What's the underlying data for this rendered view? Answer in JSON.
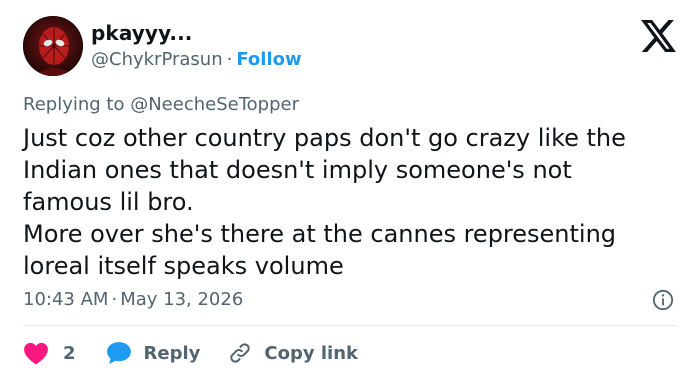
{
  "author": {
    "display_name": "pkayyy...",
    "handle": "@ChykrPrasun",
    "follow_label": "Follow"
  },
  "reply_context": {
    "prefix": "Replying to",
    "mention": "@NeecheSeTopper"
  },
  "tweet": {
    "lines": [
      "Just coz other country paps don't go crazy like the",
      "Indian ones that doesn't imply someone's not",
      "famous lil bro.",
      "More over she's there at the cannes representing",
      "loreal itself speaks volume"
    ],
    "time": "10:43 AM",
    "date": "May 13, 2026"
  },
  "actions": {
    "like_count": "2",
    "reply_label": "Reply",
    "copy_link_label": "Copy link"
  },
  "colors": {
    "like": "#f91880",
    "reply": "#1d9bf0",
    "link": "#1d9bf0",
    "muted": "#536471"
  },
  "icons": {
    "brand": "x-logo-icon",
    "info": "info-icon",
    "like": "heart-icon",
    "reply": "speech-bubble-icon",
    "copy": "link-icon"
  }
}
